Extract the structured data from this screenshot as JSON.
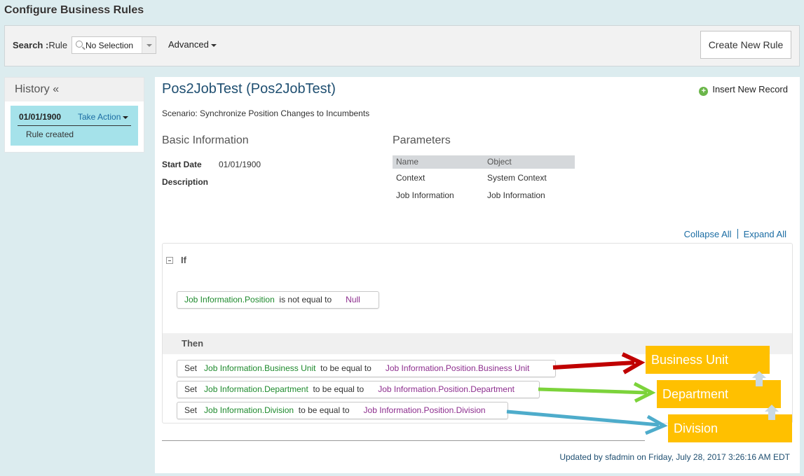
{
  "page": {
    "title": "Configure Business Rules"
  },
  "search": {
    "label_bold": "Search :",
    "label_field": "Rule",
    "selected": "No Selection",
    "advanced": "Advanced",
    "create_button": "Create New Rule"
  },
  "history": {
    "title": "History «",
    "entries": [
      {
        "date": "01/01/1900",
        "action": "Take Action",
        "note": "Rule created"
      }
    ]
  },
  "rule": {
    "title": "Pos2JobTest (Pos2JobTest)",
    "insert": "Insert New Record",
    "scenario": "Scenario: Synchronize Position Changes to Incumbents",
    "basic_info": {
      "heading": "Basic Information",
      "start_date_label": "Start Date",
      "start_date": "01/01/1900",
      "description_label": "Description"
    },
    "parameters": {
      "heading": "Parameters",
      "columns": [
        "Name",
        "Object"
      ],
      "rows": [
        {
          "name": "Context",
          "object": "System Context"
        },
        {
          "name": "Job Information",
          "object": "Job Information"
        }
      ]
    },
    "collapse_all": "Collapse All",
    "expand_all": "Expand All",
    "if_label": "If",
    "if_condition": {
      "field": "Job Information.Position",
      "op": "is not equal to",
      "value": "Null"
    },
    "then_label": "Then",
    "then_actions": [
      {
        "set": "Set",
        "field": "Job Information.Business Unit",
        "op": "to be equal to",
        "value": "Job Information.Position.Business Unit"
      },
      {
        "set": "Set",
        "field": "Job Information.Department",
        "op": "to be equal to",
        "value": "Job Information.Position.Department"
      },
      {
        "set": "Set",
        "field": "Job Information.Division",
        "op": "to be equal to",
        "value": "Job Information.Position.Division"
      }
    ],
    "updated": "Updated by sfadmin on Friday, July 28, 2017 3:26:16 AM EDT"
  },
  "annotations": {
    "labels": [
      "Business Unit",
      "Department",
      "Division"
    ],
    "colors": {
      "business_unit": "#c00000",
      "department": "#7cd33b",
      "division": "#4eaccb",
      "tag": "#ffc000"
    }
  }
}
